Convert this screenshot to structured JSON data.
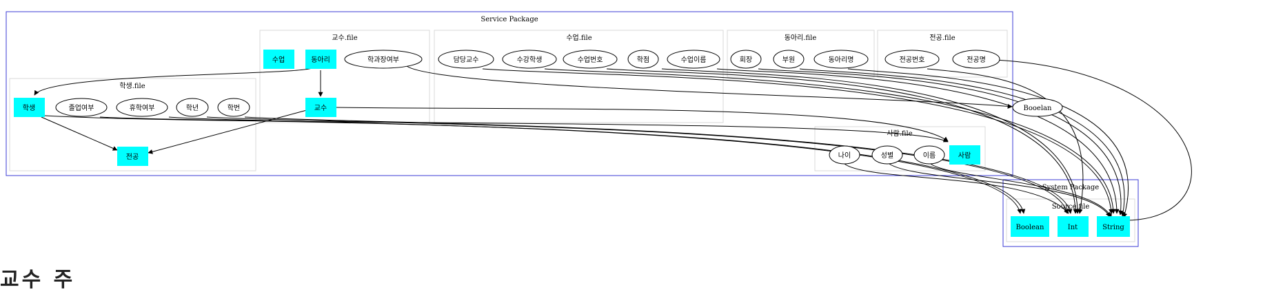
{
  "clusters": {
    "service_package": "Service Package",
    "professor_file": "교수.file",
    "lecture_file": "수업.file",
    "club_file": "동아리.file",
    "major_file": "전공.file",
    "student_file": "학생.file",
    "person_file": "사람.file",
    "system_package": "System Package",
    "source_file": "Source.file"
  },
  "nodes": {
    "prof_lecture": "수업",
    "prof_club": "동아리",
    "prof_tenure": "학과장여부",
    "prof": "교수",
    "lec_teacher": "담당교수",
    "lec_students": "수강학생",
    "lec_number": "수업번호",
    "lec_credit": "학점",
    "lec_name": "수업이름",
    "club_leader": "회장",
    "club_member": "부원",
    "club_name": "동아리명",
    "major_number": "전공번호",
    "major_name": "전공명",
    "student": "학생",
    "stu_graduated": "졸업여부",
    "stu_leave": "휴학여부",
    "stu_year": "학년",
    "stu_id": "학번",
    "stu_major": "전공",
    "person_age": "나이",
    "person_gender": "성별",
    "person_name": "이름",
    "person": "사람",
    "booelan": "Booelan",
    "sys_boolean": "Boolean",
    "sys_int": "Int",
    "sys_string": "String"
  },
  "colors": {
    "highlight": "#00ffff",
    "service_border": "#3b3bd6",
    "system_border": "#3b3bd6",
    "file_border": "#d9d9d9"
  },
  "page_heading": "교수 주"
}
